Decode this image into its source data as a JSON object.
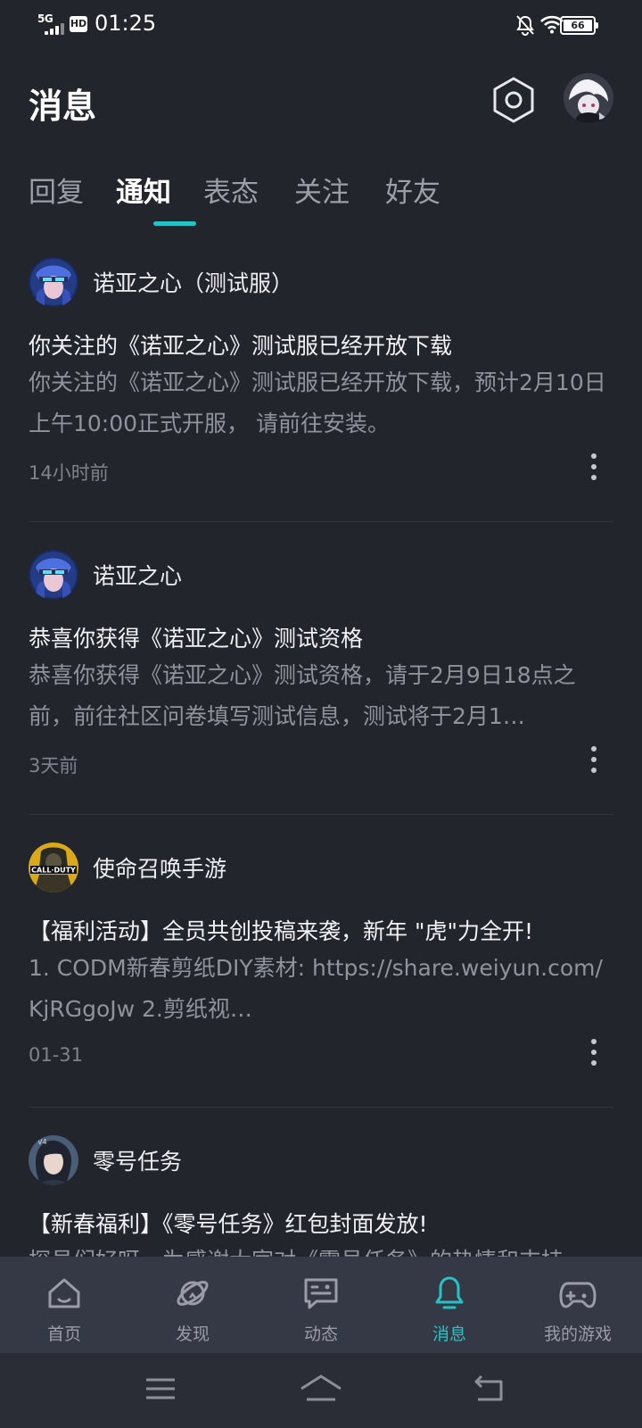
{
  "status_bar": {
    "network": "5G",
    "hd": "HD",
    "time": "01:25",
    "battery": "66"
  },
  "header": {
    "title": "消息"
  },
  "tabs": [
    {
      "label": "回复",
      "active": false
    },
    {
      "label": "通知",
      "active": true
    },
    {
      "label": "表态",
      "active": false
    },
    {
      "label": "关注",
      "active": false
    },
    {
      "label": "好友",
      "active": false
    }
  ],
  "notices": [
    {
      "sender": "诺亚之心（测试服）",
      "headline": "你关注的《诺亚之心》测试服已经开放下载",
      "body": "你关注的《诺亚之心》测试服已经开放下载，预计2月10日上午10:00正式开服，  请前往安装。",
      "time": "14小时前"
    },
    {
      "sender": "诺亚之心",
      "headline": "恭喜你获得《诺亚之心》测试资格",
      "body": "恭喜你获得《诺亚之心》测试资格，请于2月9日18点之前，前往社区问卷填写测试信息，测试将于2月1…",
      "time": "3天前"
    },
    {
      "sender": "使命召唤手游",
      "headline": "【福利活动】全员共创投稿来袭，新年 \"虎\"力全开!",
      "body": "1.  CODM新春剪纸DIY素材:  https://share.weiyun.com/KjRGgoJw  2.剪纸视…",
      "time": "01-31"
    },
    {
      "sender": "零号任务",
      "headline": "【新春福利】《零号任务》红包封面发放!",
      "body": "探员们好呀，为感谢大家对《零号任务》的热情和支持",
      "time": ""
    }
  ],
  "bottom_nav": [
    {
      "label": "首页",
      "icon": "home-icon",
      "active": false
    },
    {
      "label": "发现",
      "icon": "planet-icon",
      "active": false
    },
    {
      "label": "动态",
      "icon": "feed-icon",
      "active": false
    },
    {
      "label": "消息",
      "icon": "bell-icon",
      "active": true
    },
    {
      "label": "我的游戏",
      "icon": "gamepad-icon",
      "active": false
    }
  ],
  "colors": {
    "background": "#23252d",
    "accent": "#25c3c6",
    "nav_background": "#353845"
  }
}
